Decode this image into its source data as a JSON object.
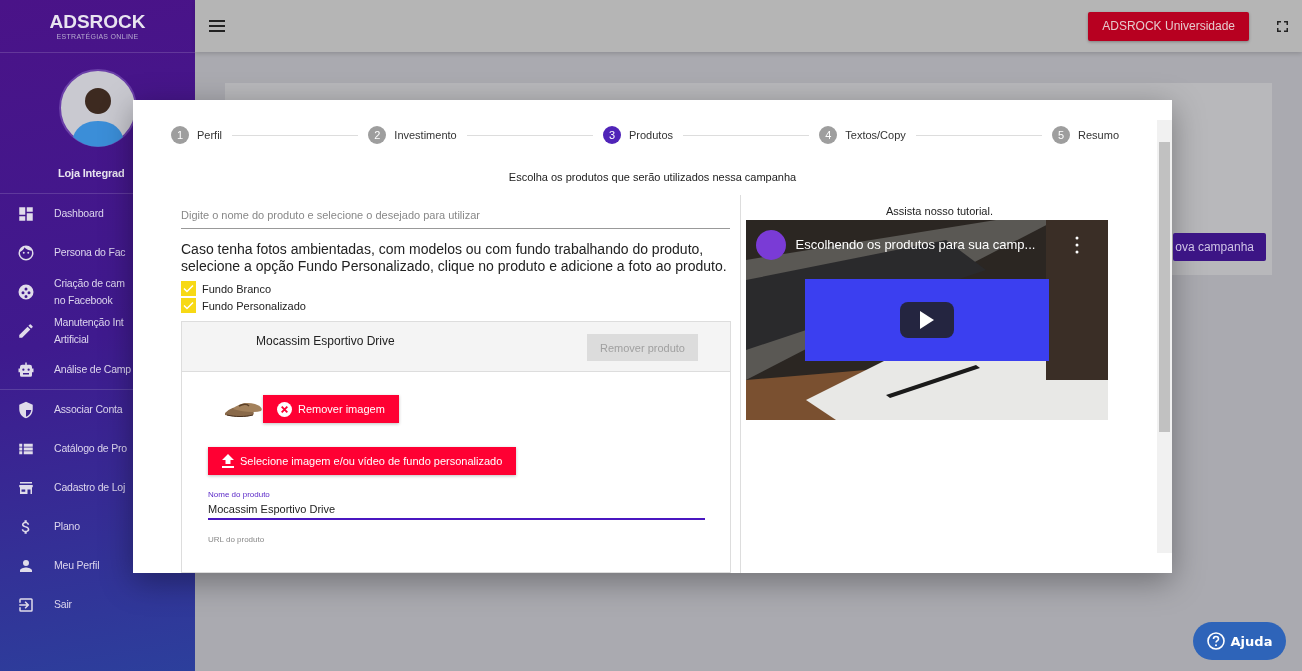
{
  "sidebar": {
    "logo": "ADSROCK",
    "logo_tagline": "ESTRATÉGIAS ONLINE",
    "user_name": "Loja Integrad",
    "groups": [
      [
        {
          "label": "Dashboard",
          "kind": "dashboard"
        },
        {
          "label": "Persona do Fac",
          "kind": "face"
        },
        {
          "label": "Criação de cam\nno Facebook",
          "kind": "reel"
        },
        {
          "label": "Manutenção Int\nArtificial",
          "kind": "pencil"
        },
        {
          "label": "Análise de Camp",
          "kind": "robot"
        }
      ],
      [
        {
          "label": "Associar Conta",
          "kind": "shield"
        },
        {
          "label": "Catálogo de Pro",
          "kind": "list"
        },
        {
          "label": "Cadastro de Loj",
          "kind": "store"
        },
        {
          "label": "Plano",
          "kind": "dollar"
        },
        {
          "label": "Meu Perfil",
          "kind": "person"
        },
        {
          "label": "Sair",
          "kind": "exit"
        }
      ]
    ]
  },
  "topbar": {
    "university_button": "ADSROCK Universidade"
  },
  "background": {
    "new_campaign_button": "ova campanha"
  },
  "modal": {
    "steps": [
      {
        "number": "1",
        "label": "Perfil",
        "selected": false
      },
      {
        "number": "2",
        "label": "Investimento",
        "selected": false
      },
      {
        "number": "3",
        "label": "Produtos",
        "selected": true
      },
      {
        "number": "4",
        "label": "Textos/Copy",
        "selected": false
      },
      {
        "number": "5",
        "label": "Resumo",
        "selected": false
      }
    ],
    "instruction": "Escolha os produtos que serão utilizados nessa campanha",
    "search": {
      "placeholder": "Digite o nome do produto e selecione o desejado para utilizar"
    },
    "info": "Caso tenha fotos ambientadas, com modelos ou com fundo trabalhando do produto, selecione a opção Fundo Personalizado, clique no produto e adicione a foto ao produto.",
    "options": [
      {
        "label": "Fundo Branco",
        "checked": true
      },
      {
        "label": "Fundo Personalizado",
        "checked": true
      }
    ],
    "product": {
      "name": "Mocassim Esportivo Drive",
      "remove_button": {
        "label": "Remover produto",
        "disabled": true
      },
      "remove_image_button": "Remover imagem",
      "upload_button": "Selecione imagem e/ou vídeo de fundo personalizado",
      "fields": [
        {
          "label": "Nome do produto",
          "value": "Mocassim Esportivo Drive",
          "focused": true
        },
        {
          "label": "URL do produto",
          "focused": false
        }
      ]
    },
    "tutorial": {
      "caption": "Assista nosso tutorial.",
      "video_title": "Escolhendo os produtos para sua camp..."
    }
  },
  "help_button": "Ajuda"
}
